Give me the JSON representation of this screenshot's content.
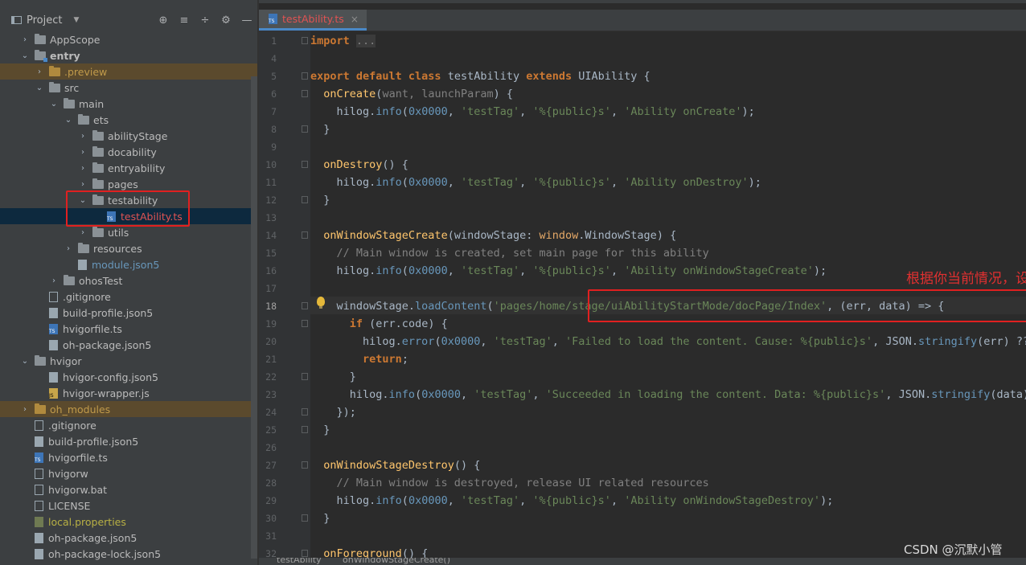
{
  "project_panel": {
    "title": "Project",
    "tools": [
      "⊕",
      "≡",
      "÷",
      "⚙",
      "—"
    ]
  },
  "tree": [
    {
      "label": "AppScope",
      "depth": 1,
      "arrow": "›",
      "icon": "folder-icon",
      "style": ""
    },
    {
      "label": "entry",
      "depth": 1,
      "arrow": "⌄",
      "icon": "module-folder-icon",
      "style": "bold"
    },
    {
      "label": ".preview",
      "depth": 2,
      "arrow": "›",
      "icon": "folder-orange-icon",
      "style": "orange-bg"
    },
    {
      "label": "src",
      "depth": 2,
      "arrow": "⌄",
      "icon": "folder-icon",
      "style": ""
    },
    {
      "label": "main",
      "depth": 3,
      "arrow": "⌄",
      "icon": "folder-icon",
      "style": ""
    },
    {
      "label": "ets",
      "depth": 4,
      "arrow": "⌄",
      "icon": "folder-icon",
      "style": ""
    },
    {
      "label": "abilityStage",
      "depth": 5,
      "arrow": "›",
      "icon": "folder-icon",
      "style": ""
    },
    {
      "label": "docability",
      "depth": 5,
      "arrow": "›",
      "icon": "folder-icon",
      "style": ""
    },
    {
      "label": "entryability",
      "depth": 5,
      "arrow": "›",
      "icon": "folder-icon",
      "style": ""
    },
    {
      "label": "pages",
      "depth": 5,
      "arrow": "›",
      "icon": "folder-icon",
      "style": ""
    },
    {
      "label": "testability",
      "depth": 5,
      "arrow": "⌄",
      "icon": "folder-icon",
      "style": ""
    },
    {
      "label": "testAbility.ts",
      "depth": 6,
      "arrow": "",
      "icon": "ts-file-icon",
      "style": "sel red"
    },
    {
      "label": "utils",
      "depth": 5,
      "arrow": "›",
      "icon": "folder-icon",
      "style": ""
    },
    {
      "label": "resources",
      "depth": 4,
      "arrow": "›",
      "icon": "folder-icon",
      "style": ""
    },
    {
      "label": "module.json5",
      "depth": 4,
      "arrow": "",
      "icon": "json-file-icon",
      "style": "blue"
    },
    {
      "label": "ohosTest",
      "depth": 3,
      "arrow": "›",
      "icon": "folder-icon",
      "style": ""
    },
    {
      "label": ".gitignore",
      "depth": 2,
      "arrow": "",
      "icon": "text-file-icon",
      "style": ""
    },
    {
      "label": "build-profile.json5",
      "depth": 2,
      "arrow": "",
      "icon": "json-file-icon",
      "style": ""
    },
    {
      "label": "hvigorfile.ts",
      "depth": 2,
      "arrow": "",
      "icon": "ts-file-icon",
      "style": ""
    },
    {
      "label": "oh-package.json5",
      "depth": 2,
      "arrow": "",
      "icon": "json-file-icon",
      "style": ""
    },
    {
      "label": "hvigor",
      "depth": 1,
      "arrow": "⌄",
      "icon": "folder-icon",
      "style": ""
    },
    {
      "label": "hvigor-config.json5",
      "depth": 2,
      "arrow": "",
      "icon": "json-file-icon",
      "style": ""
    },
    {
      "label": "hvigor-wrapper.js",
      "depth": 2,
      "arrow": "",
      "icon": "js-file-icon",
      "style": ""
    },
    {
      "label": "oh_modules",
      "depth": 1,
      "arrow": "›",
      "icon": "folder-orange-icon",
      "style": "orange-bg"
    },
    {
      "label": ".gitignore",
      "depth": 1,
      "arrow": "",
      "icon": "text-file-icon",
      "style": ""
    },
    {
      "label": "build-profile.json5",
      "depth": 1,
      "arrow": "",
      "icon": "json-file-icon",
      "style": ""
    },
    {
      "label": "hvigorfile.ts",
      "depth": 1,
      "arrow": "",
      "icon": "ts-file-icon",
      "style": ""
    },
    {
      "label": "hvigorw",
      "depth": 1,
      "arrow": "",
      "icon": "text-file-icon",
      "style": ""
    },
    {
      "label": "hvigorw.bat",
      "depth": 1,
      "arrow": "",
      "icon": "text-file-icon",
      "style": ""
    },
    {
      "label": "LICENSE",
      "depth": 1,
      "arrow": "",
      "icon": "text-file-icon",
      "style": ""
    },
    {
      "label": "local.properties",
      "depth": 1,
      "arrow": "",
      "icon": "properties-file-icon",
      "style": "yellow"
    },
    {
      "label": "oh-package.json5",
      "depth": 1,
      "arrow": "",
      "icon": "json-file-icon",
      "style": ""
    },
    {
      "label": "oh-package-lock.json5",
      "depth": 1,
      "arrow": "",
      "icon": "json-file-icon",
      "style": ""
    }
  ],
  "editor": {
    "tab_label": "testAbility.ts",
    "tab_close": "×",
    "current_line": "18",
    "lines": [
      {
        "n": "1",
        "tokens": [
          [
            "kw",
            "import"
          ],
          [
            "plain",
            " "
          ],
          [
            "fold-import",
            "..."
          ]
        ]
      },
      {
        "n": "4",
        "tokens": []
      },
      {
        "n": "5",
        "tokens": [
          [
            "kw",
            "export default class "
          ],
          [
            "plain",
            "testAbility "
          ],
          [
            "kw",
            "extends "
          ],
          [
            "plain",
            "UIAbility {"
          ]
        ]
      },
      {
        "n": "6",
        "tokens": [
          [
            "plain",
            "  "
          ],
          [
            "fn",
            "onCreate"
          ],
          [
            "plain",
            "("
          ],
          [
            "cmt",
            "want, launchParam"
          ],
          [
            "plain",
            ") {"
          ]
        ]
      },
      {
        "n": "7",
        "tokens": [
          [
            "plain",
            "    hilog."
          ],
          [
            "mth",
            "info"
          ],
          [
            "plain",
            "("
          ],
          [
            "num",
            "0x0000"
          ],
          [
            "plain",
            ", "
          ],
          [
            "str",
            "'testTag'"
          ],
          [
            "plain",
            ", "
          ],
          [
            "str",
            "'%{public}s'"
          ],
          [
            "plain",
            ", "
          ],
          [
            "str",
            "'Ability onCreate'"
          ],
          [
            "plain",
            ");"
          ]
        ]
      },
      {
        "n": "8",
        "tokens": [
          [
            "plain",
            "  }"
          ]
        ]
      },
      {
        "n": "9",
        "tokens": []
      },
      {
        "n": "10",
        "tokens": [
          [
            "plain",
            "  "
          ],
          [
            "fn",
            "onDestroy"
          ],
          [
            "plain",
            "() {"
          ]
        ]
      },
      {
        "n": "11",
        "tokens": [
          [
            "plain",
            "    hilog."
          ],
          [
            "mth",
            "info"
          ],
          [
            "plain",
            "("
          ],
          [
            "num",
            "0x0000"
          ],
          [
            "plain",
            ", "
          ],
          [
            "str",
            "'testTag'"
          ],
          [
            "plain",
            ", "
          ],
          [
            "str",
            "'%{public}s'"
          ],
          [
            "plain",
            ", "
          ],
          [
            "str",
            "'Ability onDestroy'"
          ],
          [
            "plain",
            ");"
          ]
        ]
      },
      {
        "n": "12",
        "tokens": [
          [
            "plain",
            "  }"
          ]
        ]
      },
      {
        "n": "13",
        "tokens": []
      },
      {
        "n": "14",
        "tokens": [
          [
            "plain",
            "  "
          ],
          [
            "fn",
            "onWindowStageCreate"
          ],
          [
            "plain",
            "(windowStage: "
          ],
          [
            "type",
            "window"
          ],
          [
            "plain",
            ".WindowStage) {"
          ]
        ]
      },
      {
        "n": "15",
        "tokens": [
          [
            "cmt",
            "    // Main window is created, set main page for this ability"
          ]
        ]
      },
      {
        "n": "16",
        "tokens": [
          [
            "plain",
            "    hilog."
          ],
          [
            "mth",
            "info"
          ],
          [
            "plain",
            "("
          ],
          [
            "num",
            "0x0000"
          ],
          [
            "plain",
            ", "
          ],
          [
            "str",
            "'testTag'"
          ],
          [
            "plain",
            ", "
          ],
          [
            "str",
            "'%{public}s'"
          ],
          [
            "plain",
            ", "
          ],
          [
            "str",
            "'Ability onWindowStageCreate'"
          ],
          [
            "plain",
            ");"
          ]
        ]
      },
      {
        "n": "17",
        "tokens": []
      },
      {
        "n": "18",
        "tokens": [
          [
            "plain",
            "    windowStage."
          ],
          [
            "mth",
            "loadContent"
          ],
          [
            "plain",
            "("
          ],
          [
            "str",
            "'pages/home/stage/uiAbilityStartMode/docPage/Index'"
          ],
          [
            "plain",
            ", (err, data) => {"
          ]
        ]
      },
      {
        "n": "19",
        "tokens": [
          [
            "plain",
            "      "
          ],
          [
            "kw",
            "if "
          ],
          [
            "plain",
            "(err.code) {"
          ]
        ]
      },
      {
        "n": "20",
        "tokens": [
          [
            "plain",
            "        hilog."
          ],
          [
            "mth",
            "error"
          ],
          [
            "plain",
            "("
          ],
          [
            "num",
            "0x0000"
          ],
          [
            "plain",
            ", "
          ],
          [
            "str",
            "'testTag'"
          ],
          [
            "plain",
            ", "
          ],
          [
            "str",
            "'Failed to load the content. Cause: %{public}s'"
          ],
          [
            "plain",
            ", JSON."
          ],
          [
            "mth",
            "stringify"
          ],
          [
            "plain",
            "(err) ??"
          ]
        ]
      },
      {
        "n": "21",
        "tokens": [
          [
            "plain",
            "        "
          ],
          [
            "kw",
            "return"
          ],
          [
            "plain",
            ";"
          ]
        ]
      },
      {
        "n": "22",
        "tokens": [
          [
            "plain",
            "      }"
          ]
        ]
      },
      {
        "n": "23",
        "tokens": [
          [
            "plain",
            "      hilog."
          ],
          [
            "mth",
            "info"
          ],
          [
            "plain",
            "("
          ],
          [
            "num",
            "0x0000"
          ],
          [
            "plain",
            ", "
          ],
          [
            "str",
            "'testTag'"
          ],
          [
            "plain",
            ", "
          ],
          [
            "str",
            "'Succeeded in loading the content. Data: %{public}s'"
          ],
          [
            "plain",
            ", JSON."
          ],
          [
            "mth",
            "stringify"
          ],
          [
            "plain",
            "(data)"
          ]
        ]
      },
      {
        "n": "24",
        "tokens": [
          [
            "plain",
            "    });"
          ]
        ]
      },
      {
        "n": "25",
        "tokens": [
          [
            "plain",
            "  }"
          ]
        ]
      },
      {
        "n": "26",
        "tokens": []
      },
      {
        "n": "27",
        "tokens": [
          [
            "plain",
            "  "
          ],
          [
            "fn",
            "onWindowStageDestroy"
          ],
          [
            "plain",
            "() {"
          ]
        ]
      },
      {
        "n": "28",
        "tokens": [
          [
            "cmt",
            "    // Main window is destroyed, release UI related resources"
          ]
        ]
      },
      {
        "n": "29",
        "tokens": [
          [
            "plain",
            "    hilog."
          ],
          [
            "mth",
            "info"
          ],
          [
            "plain",
            "("
          ],
          [
            "num",
            "0x0000"
          ],
          [
            "plain",
            ", "
          ],
          [
            "str",
            "'testTag'"
          ],
          [
            "plain",
            ", "
          ],
          [
            "str",
            "'%{public}s'"
          ],
          [
            "plain",
            ", "
          ],
          [
            "str",
            "'Ability onWindowStageDestroy'"
          ],
          [
            "plain",
            ");"
          ]
        ]
      },
      {
        "n": "30",
        "tokens": [
          [
            "plain",
            "  }"
          ]
        ]
      },
      {
        "n": "31",
        "tokens": []
      },
      {
        "n": "32",
        "tokens": [
          [
            "plain",
            "  "
          ],
          [
            "fn",
            "onForeground"
          ],
          [
            "plain",
            "() {"
          ]
        ]
      }
    ]
  },
  "annotation": "根据你当前情况，设为你自己的页面加载路劲",
  "watermark": "CSDN @沉默小管",
  "bottom_bar": {
    "left": "testAbility",
    "right": "onWindowStageCreate()"
  },
  "colors": {
    "accent": "#4a88c7",
    "annotation_red": "#e02020",
    "selection": "#0d293e"
  }
}
